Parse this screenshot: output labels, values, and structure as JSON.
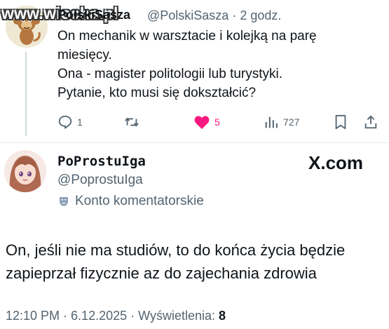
{
  "watermark": "www.wiocha.pl",
  "tweet": {
    "author_name": "PolskiSasza",
    "handle": "@PolskiSasza",
    "time_sep": "·",
    "time": "2 godz.",
    "lines": [
      "On mechanik w warsztacie i kolejką na parę",
      "miesięcy.",
      "Ona - magister politologii lub turystyki.",
      "Pytanie, kto musi się dokształcić?"
    ],
    "actions": {
      "reply_count": "1",
      "retweet_count": "",
      "like_count": "5",
      "view_count": "727"
    },
    "colors": {
      "like": "#f91880",
      "muted": "#536471"
    }
  },
  "reply": {
    "name": "PoProstuIga",
    "handle": "@PoprostuIga",
    "account_type": "Konto komentatorskie",
    "brand": "X.com",
    "lines": [
      "On, jeśli nie ma studiów, to do końca życia będzie",
      "zapieprzał fizycznie az do zajechania zdrowia"
    ],
    "footer": {
      "time": "12:10 PM",
      "sep1": " · ",
      "date": "6.12.2025",
      "sep2": " · ",
      "views_label": "Wyświetlenia: ",
      "views_count": "8"
    }
  }
}
